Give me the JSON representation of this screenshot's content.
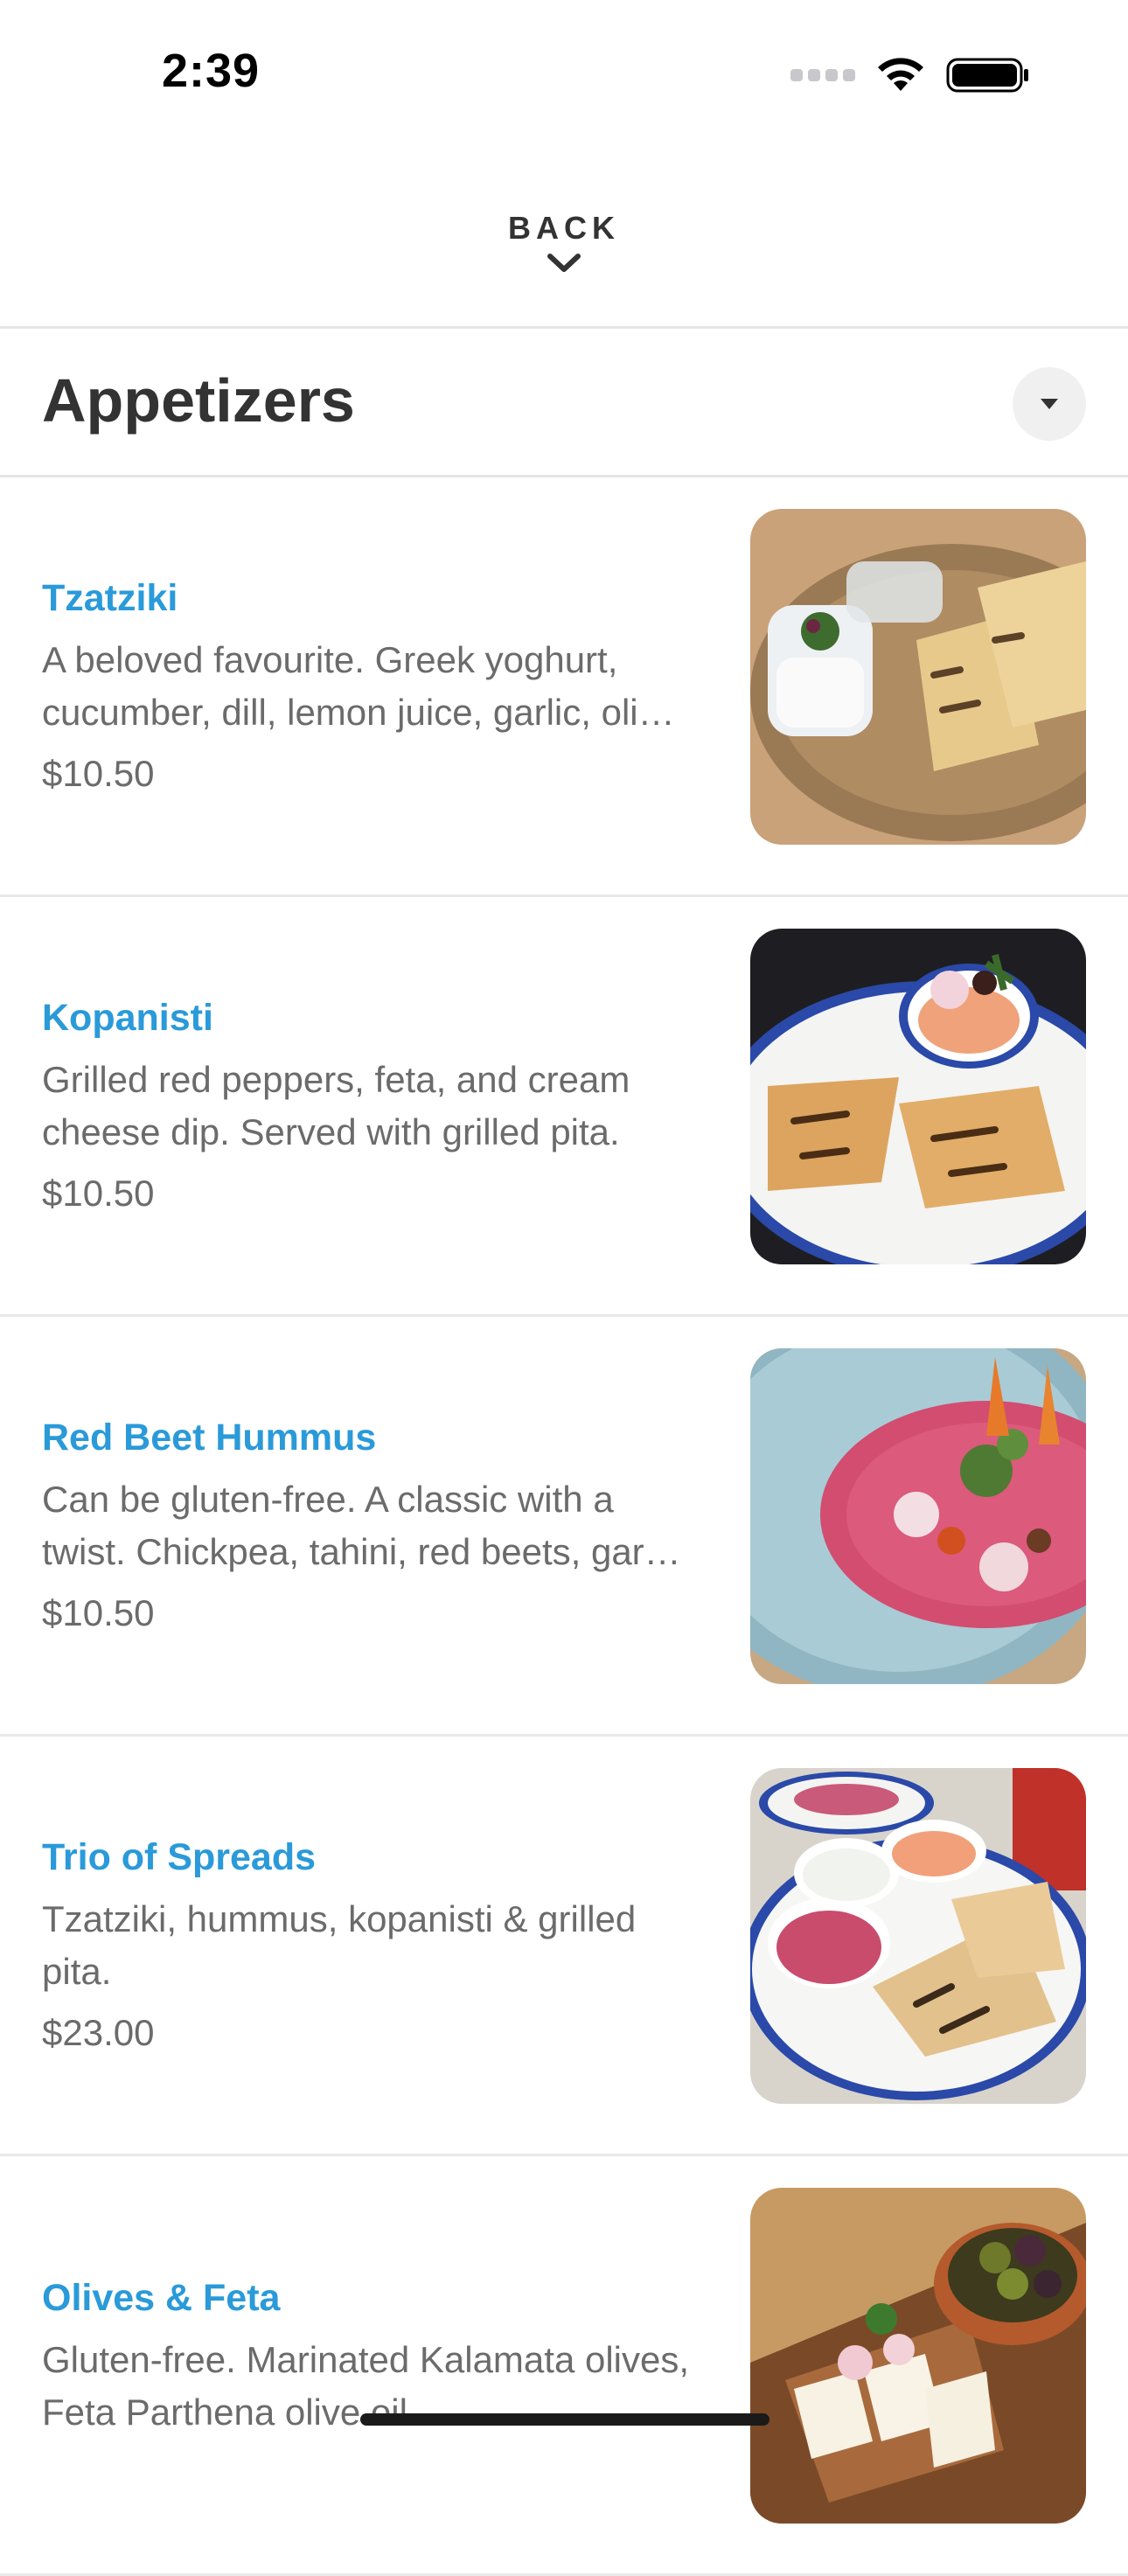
{
  "status_bar": {
    "time": "2:39"
  },
  "header": {
    "back_label": "BACK"
  },
  "section": {
    "title": "Appetizers"
  },
  "items": [
    {
      "name": "Tzatziki",
      "description": " A beloved favourite. Greek yoghurt, cucumber, dill, lemon juice, garlic, oli…",
      "price": "$10.50"
    },
    {
      "name": "Kopanisti",
      "description": "Grilled red peppers, feta, and cream cheese dip. Served with grilled pita.",
      "price": "$10.50"
    },
    {
      "name": "Red Beet Hummus",
      "description": "Can be gluten-free. A classic with a twist. Chickpea, tahini, red beets, gar…",
      "price": "$10.50"
    },
    {
      "name": "Trio of Spreads",
      "description": "Tzatziki, hummus, kopanisti & grilled pita.",
      "price": "$23.00"
    },
    {
      "name": "Olives & Feta",
      "description": "Gluten-free. Marinated Kalamata olives, Feta Parthena olive oil.",
      "price": ""
    }
  ],
  "icons": {
    "signal": "cellular-signal-icon",
    "wifi": "wifi-icon",
    "battery": "battery-icon",
    "back": "chevron-down-icon",
    "section_toggle": "caret-down-icon"
  },
  "colors": {
    "accent": "#2a9ad9",
    "text": "#333333",
    "muted": "#6b6b6b",
    "divider": "#e5e5e5"
  }
}
